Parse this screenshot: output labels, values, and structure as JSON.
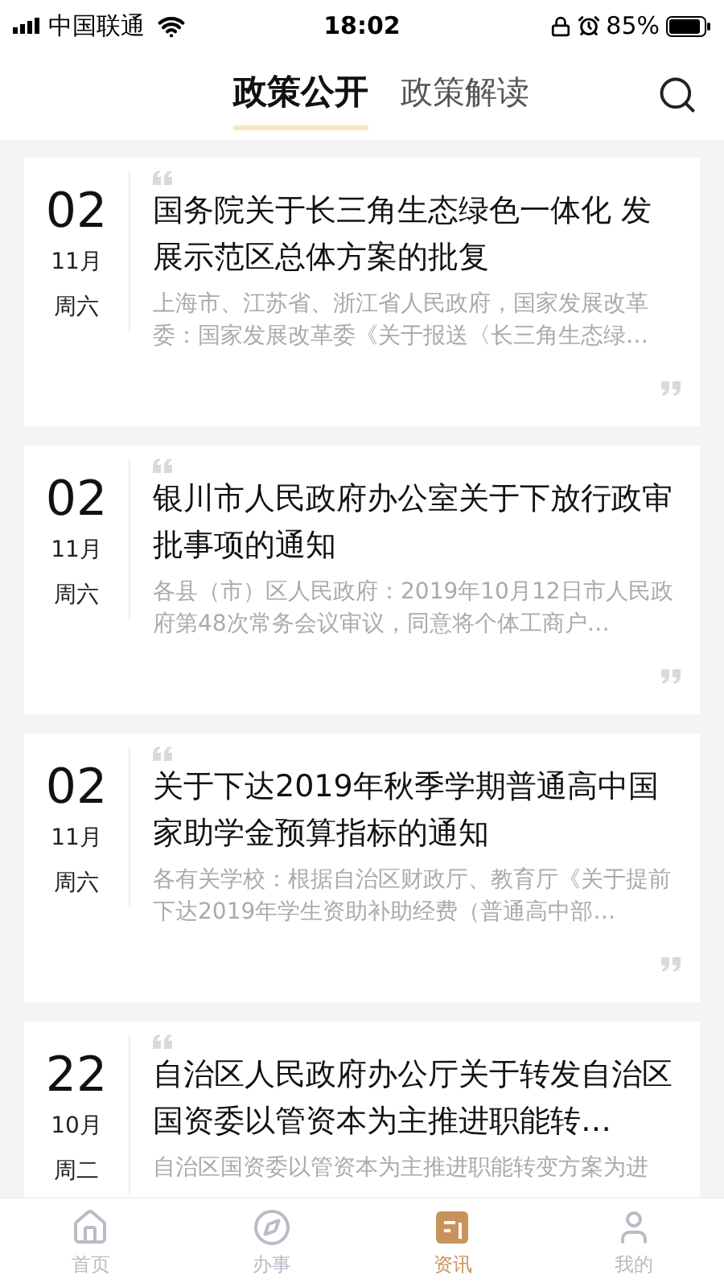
{
  "status_bar": {
    "carrier": "中国联通",
    "time": "18:02",
    "battery": "85%"
  },
  "header": {
    "tabs": [
      {
        "label": "政策公开",
        "selected": true
      },
      {
        "label": "政策解读",
        "selected": false
      }
    ]
  },
  "articles": [
    {
      "day": "02",
      "month": "11月",
      "weekday": "周六",
      "title": "国务院关于长三角生态绿色一体化 发展示范区总体方案的批复",
      "excerpt": "上海市、江苏省、浙江省人民政府，国家发展改革委：国家发展改革委《关于报送〈长三角生态绿…"
    },
    {
      "day": "02",
      "month": "11月",
      "weekday": "周六",
      "title": "银川市人民政府办公室关于下放行政审批事项的通知",
      "excerpt": "各县（市）区人民政府：2019年10月12日市人民政府第48次常务会议审议，同意将个体工商户…"
    },
    {
      "day": "02",
      "month": "11月",
      "weekday": "周六",
      "title": "关于下达2019年秋季学期普通高中国家助学金预算指标的通知",
      "excerpt": "各有关学校：根据自治区财政厅、教育厅《关于提前下达2019年学生资助补助经费（普通高中部…"
    },
    {
      "day": "22",
      "month": "10月",
      "weekday": "周二",
      "title": "自治区人民政府办公厅关于转发自治区国资委以管资本为主推进职能转…",
      "excerpt": "自治区国资委以管资本为主推进职能转变方案为进"
    }
  ],
  "tab_bar": [
    {
      "kind": "home",
      "label": "首页",
      "selected": false
    },
    {
      "kind": "compass",
      "label": "办事",
      "selected": false
    },
    {
      "kind": "news",
      "label": "资讯",
      "selected": true
    },
    {
      "kind": "user",
      "label": "我的",
      "selected": false
    }
  ]
}
